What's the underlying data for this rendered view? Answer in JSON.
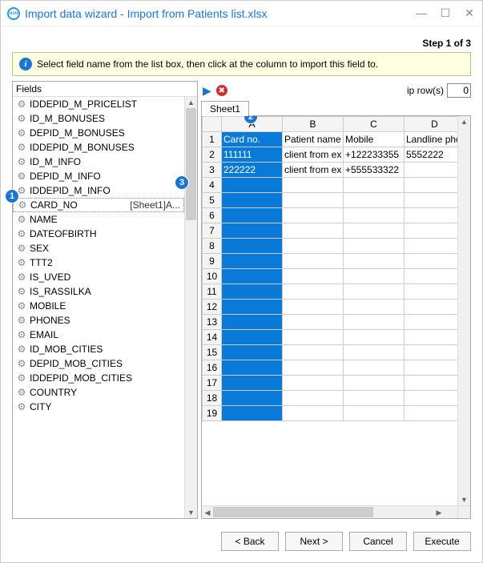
{
  "window": {
    "title": "Import data wizard - Import from Patients list.xlsx"
  },
  "step_label": "Step 1 of 3",
  "info_text": "Select field name from the list box, then click at the column to import this field to.",
  "fields_header": "Fields",
  "fields": [
    {
      "name": "IDDEPID_M_PRICELIST"
    },
    {
      "name": "ID_M_BONUSES"
    },
    {
      "name": "DEPID_M_BONUSES"
    },
    {
      "name": "IDDEPID_M_BONUSES"
    },
    {
      "name": "ID_M_INFO"
    },
    {
      "name": "DEPID_M_INFO"
    },
    {
      "name": "IDDEPID_M_INFO"
    },
    {
      "name": "CARD_NO",
      "extra": "[Sheet1]A...",
      "selected": true
    },
    {
      "name": "NAME"
    },
    {
      "name": "DATEOFBIRTH"
    },
    {
      "name": "SEX"
    },
    {
      "name": "TTT2"
    },
    {
      "name": "IS_UVED"
    },
    {
      "name": "IS_RASSILKA"
    },
    {
      "name": "MOBILE"
    },
    {
      "name": "PHONES"
    },
    {
      "name": "EMAIL"
    },
    {
      "name": "ID_MOB_CITIES"
    },
    {
      "name": "DEPID_MOB_CITIES"
    },
    {
      "name": "IDDEPID_MOB_CITIES"
    },
    {
      "name": "COUNTRY"
    },
    {
      "name": "CITY"
    }
  ],
  "skip_label": "ip row(s)",
  "skip_value": "0",
  "sheet_tab": "Sheet1",
  "columns": [
    "A",
    "B",
    "C",
    "D"
  ],
  "rows": [
    {
      "n": "1",
      "a": "Card no.",
      "b": "Patient name",
      "c": "Mobile",
      "d": "Landline phon"
    },
    {
      "n": "2",
      "a": "111111",
      "b": "client from ex",
      "c": "+122233355",
      "d": "5552222"
    },
    {
      "n": "3",
      "a": "222222",
      "b": "client from ex",
      "c": "+555533322",
      "d": ""
    },
    {
      "n": "4"
    },
    {
      "n": "5"
    },
    {
      "n": "6"
    },
    {
      "n": "7"
    },
    {
      "n": "8"
    },
    {
      "n": "9"
    },
    {
      "n": "10"
    },
    {
      "n": "11"
    },
    {
      "n": "12"
    },
    {
      "n": "13"
    },
    {
      "n": "14"
    },
    {
      "n": "15"
    },
    {
      "n": "16"
    },
    {
      "n": "17"
    },
    {
      "n": "18"
    },
    {
      "n": "19"
    }
  ],
  "buttons": {
    "back": "< Back",
    "next": "Next >",
    "cancel": "Cancel",
    "execute": "Execute"
  },
  "callouts": {
    "one": "1",
    "two": "2",
    "three": "3"
  }
}
